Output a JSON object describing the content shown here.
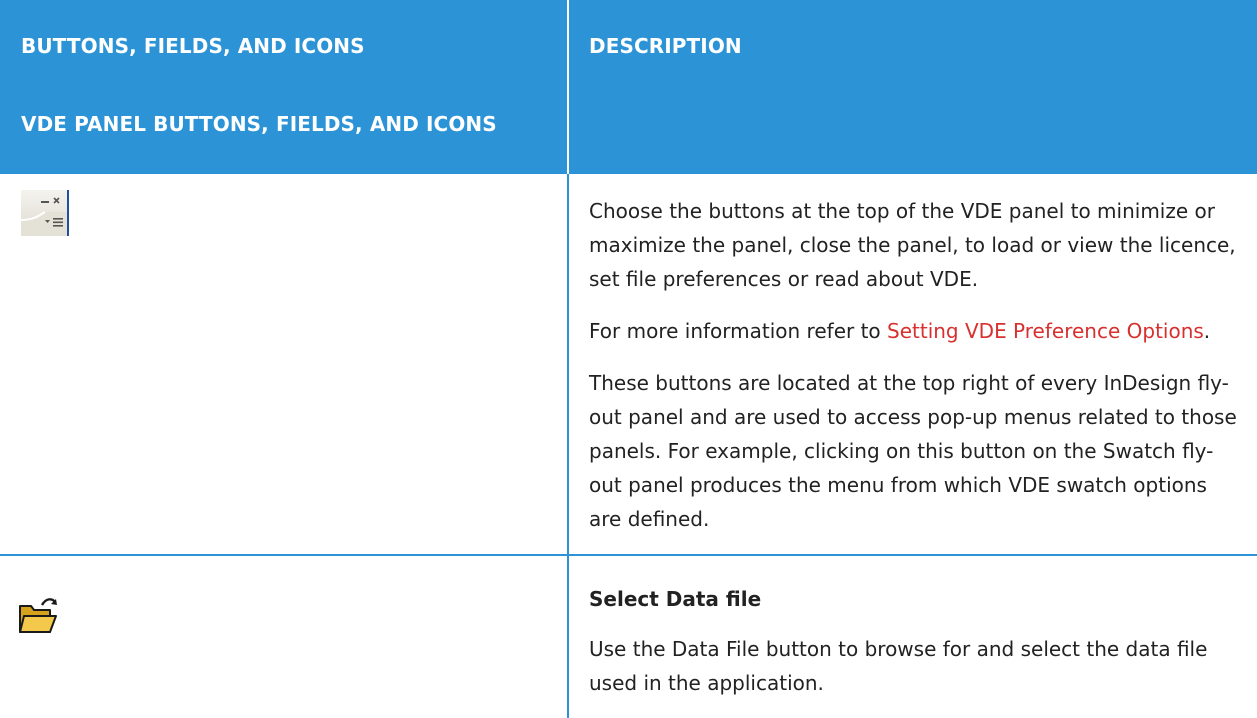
{
  "table": {
    "header": {
      "col1_line1": "BUTTONS, FIELDS, AND ICONS",
      "col1_line2": "VDE PANEL BUTTONS, FIELDS, AND ICONS",
      "col2": "DESCRIPTION"
    },
    "rows": [
      {
        "icon": "panel-window-controls-icon",
        "paragraphs": [
          "Choose the buttons at the top of the VDE panel to minimize or maximize the panel, close the panel, to load or view the licence, set file preferences or read about VDE."
        ],
        "ref_prefix": "For more information refer to ",
        "ref_link": "Setting VDE Preference Options",
        "ref_suffix": ".",
        "paragraph_after": "These buttons are located at the top right of every InDesign fly-out panel and are used to access pop-up menus related to those panels. For example, clicking on this button on the Swatch fly-out panel produces the menu from which VDE swatch options are defined."
      },
      {
        "icon": "open-folder-icon",
        "title": "Select Data file",
        "paragraphs": [
          "Use the Data File button to browse for and select the data file used in the application."
        ]
      }
    ]
  },
  "colors": {
    "header_bg": "#2b93d6",
    "header_text": "#ffffff",
    "link": "#d8302f",
    "body_text": "#222222"
  }
}
